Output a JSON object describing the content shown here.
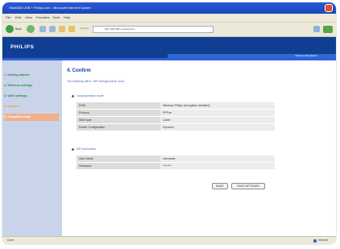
{
  "window": {
    "title": "SNA6500 USB + Philips.com - Microsoft Internet Explorer"
  },
  "menu": {
    "items": [
      "File",
      "Edit",
      "View",
      "Favorites",
      "Tools",
      "Help"
    ]
  },
  "toolbar": {
    "back_label": "Back",
    "address_label": "Address",
    "address_value": "http://192.168.1.1/setup.htm"
  },
  "header": {
    "logo": "PHILIPS",
    "submenu_label": "Wireless Broadband"
  },
  "sidebar": {
    "items": [
      {
        "label": "1. Getting started",
        "style": "green"
      },
      {
        "label": "2. Wireless settings",
        "style": "green"
      },
      {
        "label": "3. WAN settings",
        "style": "green"
      },
      {
        "label": "4. Confirm",
        "style": "orange"
      },
      {
        "label": "5. Complete setup",
        "style": "active"
      }
    ]
  },
  "content": {
    "title": "4. Confirm",
    "description": "The following office / ISP settings will be used:",
    "section1_title": "Local operation mode",
    "table1": [
      {
        "key": "SSID",
        "value": "Wireless-Philips (encryption disabled)"
      },
      {
        "key": "Protocol",
        "value": "PPPoe"
      },
      {
        "key": "WAN type",
        "value": "Cable"
      },
      {
        "key": "Router Configuration",
        "value": "Dynamic"
      }
    ],
    "section2_title": "ISP information",
    "table2": [
      {
        "key": "User Name",
        "value": "username"
      },
      {
        "key": "Password",
        "value": "********"
      }
    ],
    "back_button": "BACK",
    "save_button": "SAVE SETTINGS"
  },
  "status": {
    "left": "Done",
    "right": "Internet"
  },
  "colors": {
    "brand_blue": "#0f3e93",
    "link_green": "#2b8a3e",
    "accent_orange": "#f29a2e",
    "active_bg": "#f1b08c"
  }
}
